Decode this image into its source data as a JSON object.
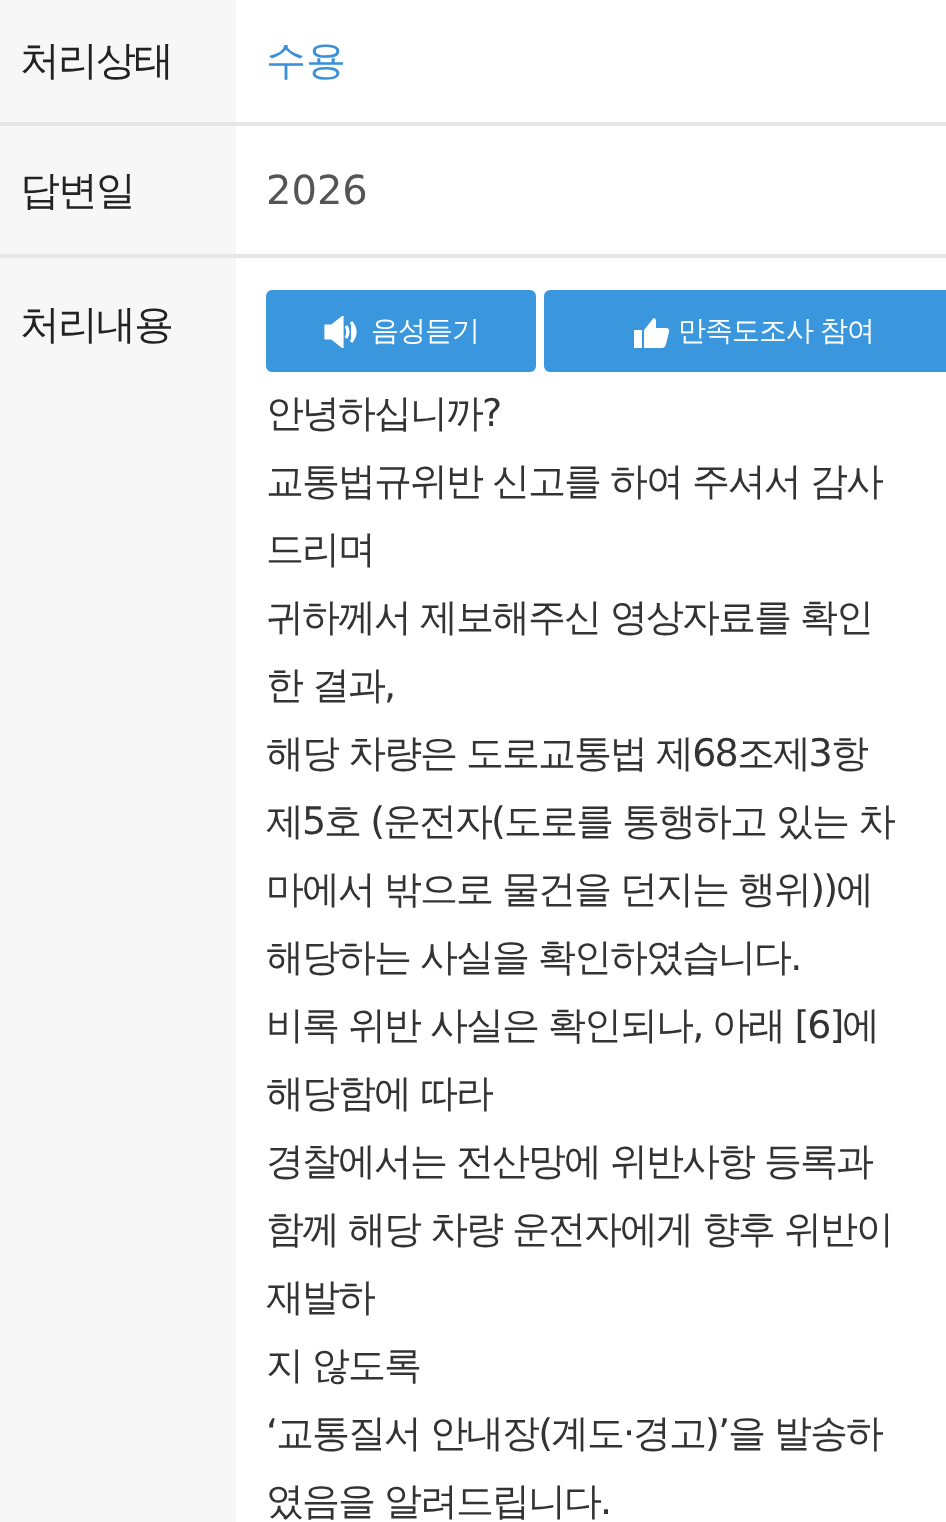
{
  "rows": [
    {
      "label": "처리상태",
      "kind": "status",
      "value": "수용"
    },
    {
      "label": "답변일",
      "kind": "plain",
      "value": "2026"
    },
    {
      "label": "처리내용",
      "kind": "content",
      "buttons": [
        {
          "kind": "speaker",
          "label": "음성듣기"
        },
        {
          "kind": "thumb",
          "label": "만족도조사 참여"
        }
      ],
      "lines": [
        "안녕하십니까?",
        "교통법규위반 신고를 하여 주셔서 감사",
        "드리며",
        "귀하께서 제보해주신 영상자료를 확인",
        "한 결과,",
        "해당 차량은 도로교통법 제68조제3항",
        "제5호 (운전자(도로를 통행하고 있는 차",
        "마에서 밖으로 물건을 던지는 행위))에",
        "해당하는 사실을 확인하였습니다.",
        "비록 위반 사실은 확인되나, 아래 [6]에",
        "해당함에 따라",
        "경찰에서는 전산망에 위반사항 등록과",
        "함께 해당 차량 운전자에게 향후 위반이",
        "재발하",
        "지 않도록",
        "‘교통질서 안내장(계도·경고)’을 발송하",
        "였음을 알려드립니다."
      ]
    }
  ]
}
